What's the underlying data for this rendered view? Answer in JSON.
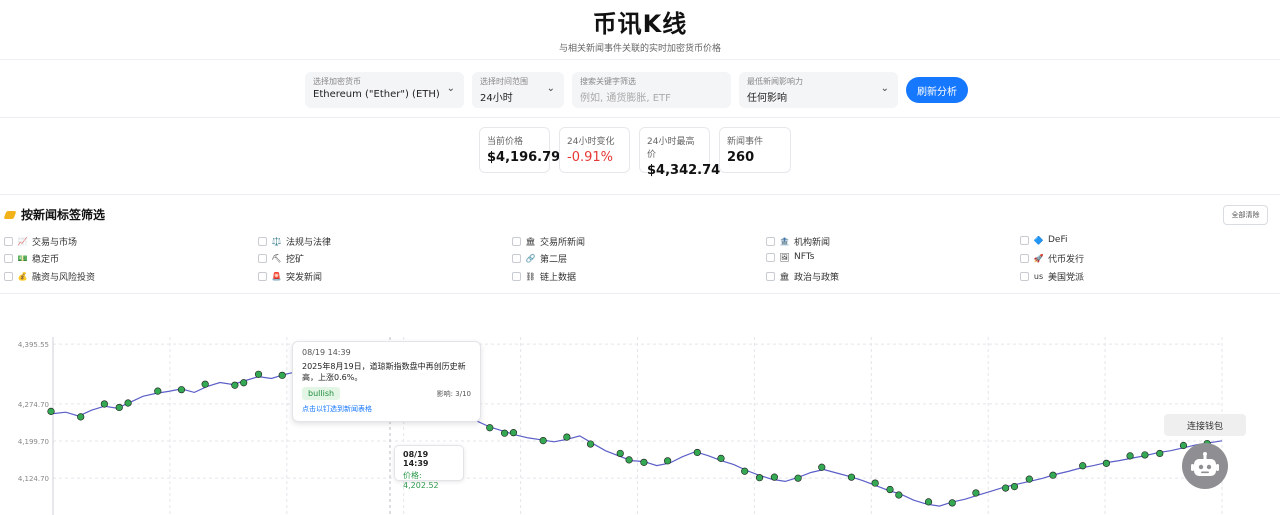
{
  "header": {
    "title": "币讯K线",
    "subtitle": "与相关新闻事件关联的实时加密货币价格"
  },
  "controls": {
    "crypto": {
      "label": "选择加密货币",
      "value": "Ethereum (\"Ether\") (ETH)"
    },
    "range": {
      "label": "选择时间范围",
      "value": "24小时"
    },
    "keyword": {
      "label": "搜索关键字筛选",
      "placeholder": "例如, 通货膨胀, ETF"
    },
    "impact": {
      "label": "最低新闻影响力",
      "value": "任何影响"
    },
    "refresh_label": "刷新分析"
  },
  "stats": [
    {
      "label": "当前价格",
      "value": "$4,196.79"
    },
    {
      "label": "24小时变化",
      "value": "-0.91%"
    },
    {
      "label": "24小时最高价",
      "value": "$4,342.74"
    },
    {
      "label": "新闻事件",
      "value": "260"
    }
  ],
  "filters": {
    "title": "按新闻标签筛选",
    "clear_all": "全部清除",
    "tags": [
      {
        "emoji": "📈",
        "label": "交易与市场"
      },
      {
        "emoji": "⚖️",
        "label": "法规与法律"
      },
      {
        "emoji": "🏛",
        "label": "交易所新闻"
      },
      {
        "emoji": "🏦",
        "label": "机构新闻"
      },
      {
        "emoji": "🔷",
        "label": "DeFi"
      },
      {
        "emoji": "💵",
        "label": "稳定币"
      },
      {
        "emoji": "⛏",
        "label": "挖矿"
      },
      {
        "emoji": "🔗",
        "label": "第二层"
      },
      {
        "emoji": "🖼",
        "label": "NFTs"
      },
      {
        "emoji": "🚀",
        "label": "代币发行"
      },
      {
        "emoji": "💰",
        "label": "融资与风险投资"
      },
      {
        "emoji": "🚨",
        "label": "突发新闻"
      },
      {
        "emoji": "⛓",
        "label": "链上数据"
      },
      {
        "emoji": "🏛",
        "label": "政治与政策"
      },
      {
        "emoji": "us",
        "label": "美国党派"
      }
    ]
  },
  "chart_data": {
    "type": "line",
    "y_ticks": [
      "4,395.55",
      "4,274.70",
      "4,199.70",
      "4,124.70"
    ],
    "ylim": [
      4050,
      4410
    ],
    "y_tick_values": [
      4395.55,
      4274.7,
      4199.7,
      4124.7
    ],
    "series": [
      {
        "values": [
          4255,
          4258,
          4250,
          4262,
          4270,
          4266,
          4278,
          4290,
          4296,
          4300,
          4305,
          4298,
          4310,
          4318,
          4314,
          4322,
          4330,
          4326,
          4334,
          4340,
          4336,
          4332,
          4342,
          4338,
          4335,
          4330,
          4332,
          4326,
          4320,
          4310,
          4290,
          4270,
          4255,
          4240,
          4228,
          4220,
          4212,
          4206,
          4202,
          4198,
          4203,
          4210,
          4195,
          4180,
          4170,
          4160,
          4158,
          4150,
          4155,
          4168,
          4178,
          4170,
          4160,
          4152,
          4140,
          4130,
          4122,
          4118,
          4126,
          4136,
          4142,
          4135,
          4128,
          4120,
          4110,
          4100,
          4092,
          4080,
          4072,
          4068,
          4076,
          4082,
          4090,
          4098,
          4106,
          4112,
          4118,
          4124,
          4132,
          4138,
          4145,
          4150,
          4156,
          4160,
          4165,
          4170,
          4176,
          4180,
          4186,
          4192,
          4196,
          4200
        ]
      }
    ],
    "annotation": {
      "date": "08/19 14:39",
      "text": "2025年8月19日，道琼斯指数盘中再创历史新高，上涨0.6%。",
      "sentiment": "bullish",
      "impact": "影响: 3/10",
      "link": "点击以钉选到新闻表格"
    },
    "hover": {
      "date": "08/19 14:39",
      "price": "价格: 4,202.52"
    }
  },
  "widgets": {
    "wallet": "连接钱包"
  }
}
